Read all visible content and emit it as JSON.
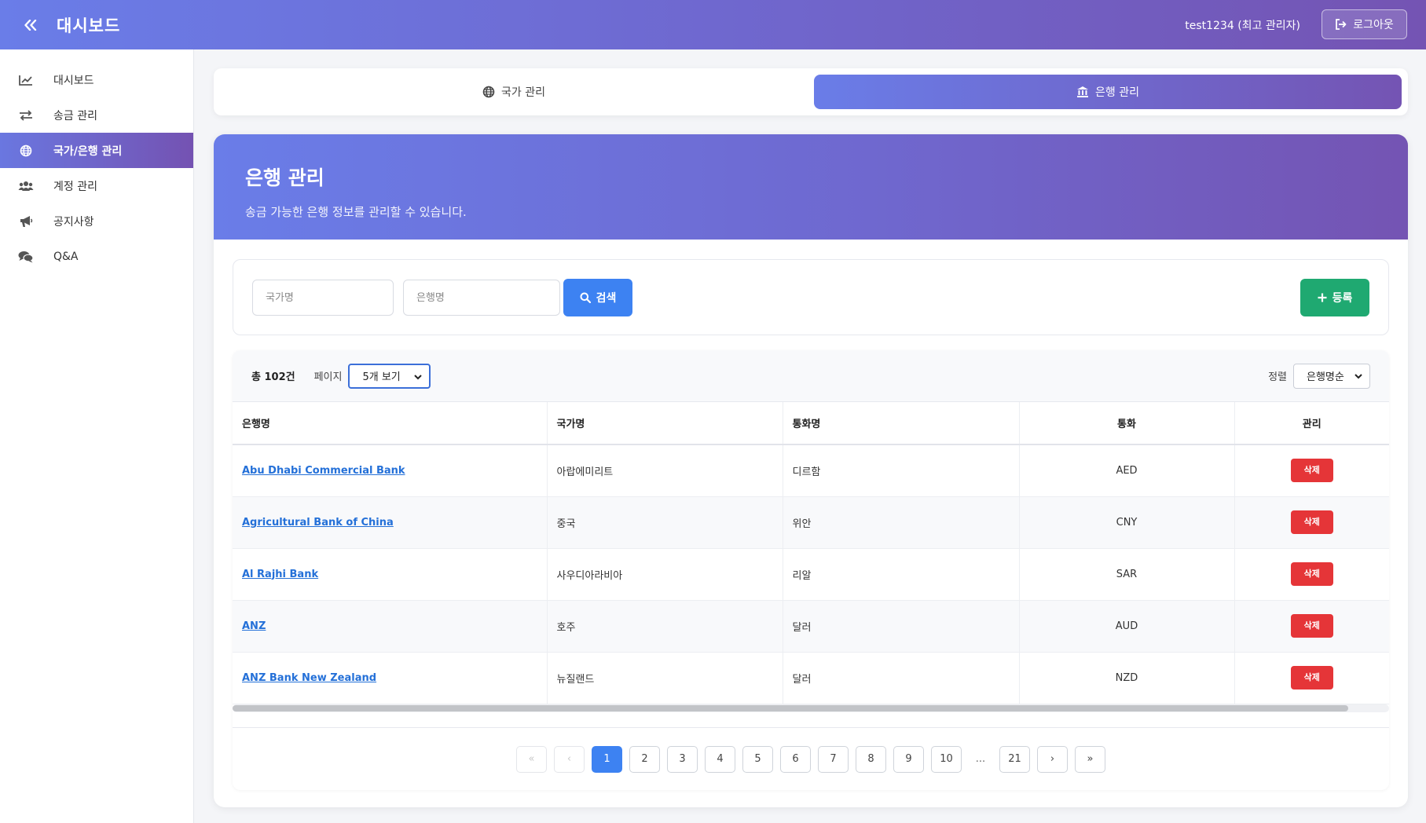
{
  "header": {
    "title": "대시보드",
    "user": "test1234 (최고 관리자)",
    "logout_label": "로그아웃"
  },
  "sidebar": {
    "items": [
      {
        "label": "대시보드",
        "icon": "chart-line-icon"
      },
      {
        "label": "송금 관리",
        "icon": "exchange-icon"
      },
      {
        "label": "국가/은행 관리",
        "icon": "globe-icon",
        "active": true
      },
      {
        "label": "계정 관리",
        "icon": "users-icon"
      },
      {
        "label": "공지사항",
        "icon": "megaphone-icon"
      },
      {
        "label": "Q&A",
        "icon": "comments-icon"
      }
    ]
  },
  "tabs": [
    {
      "label": "국가 관리",
      "icon": "globe-icon"
    },
    {
      "label": "은행 관리",
      "icon": "bank-icon",
      "active": true
    }
  ],
  "hero": {
    "title": "은행 관리",
    "subtitle": "송금 가능한 은행 정보를 관리할 수 있습니다."
  },
  "search": {
    "country_placeholder": "국가명",
    "bank_placeholder": "은행명",
    "search_label": "검색",
    "add_label": "등록"
  },
  "list": {
    "total": "총 102건",
    "page_label": "페이지",
    "page_size": "5개 보기",
    "sort_label": "정렬",
    "sort_value": "은행명순",
    "columns": [
      "은행명",
      "국가명",
      "통화명",
      "통화",
      "관리"
    ],
    "rows": [
      {
        "bank": "Abu Dhabi Commercial Bank",
        "country": "아랍에미리트",
        "currency_name": "디르함",
        "currency": "AED",
        "action": "삭제"
      },
      {
        "bank": "Agricultural Bank of China",
        "country": "중국",
        "currency_name": "위안",
        "currency": "CNY",
        "action": "삭제"
      },
      {
        "bank": "Al Rajhi Bank",
        "country": "사우디아라비아",
        "currency_name": "리알",
        "currency": "SAR",
        "action": "삭제"
      },
      {
        "bank": "ANZ",
        "country": "호주",
        "currency_name": "달러",
        "currency": "AUD",
        "action": "삭제"
      },
      {
        "bank": "ANZ Bank New Zealand",
        "country": "뉴질랜드",
        "currency_name": "달러",
        "currency": "NZD",
        "action": "삭제"
      }
    ]
  },
  "pagination": {
    "first": "«",
    "prev": "‹",
    "next": "›",
    "last": "»",
    "pages": [
      "1",
      "2",
      "3",
      "4",
      "5",
      "6",
      "7",
      "8",
      "9",
      "10"
    ],
    "ellipsis": "...",
    "last_page": "21",
    "current": "1"
  },
  "colors": {
    "accent_start": "#6a7de8",
    "accent_end": "#7454b3",
    "primary": "#3d82f2",
    "success": "#1fa971",
    "danger": "#e53538",
    "link": "#2470d8"
  }
}
